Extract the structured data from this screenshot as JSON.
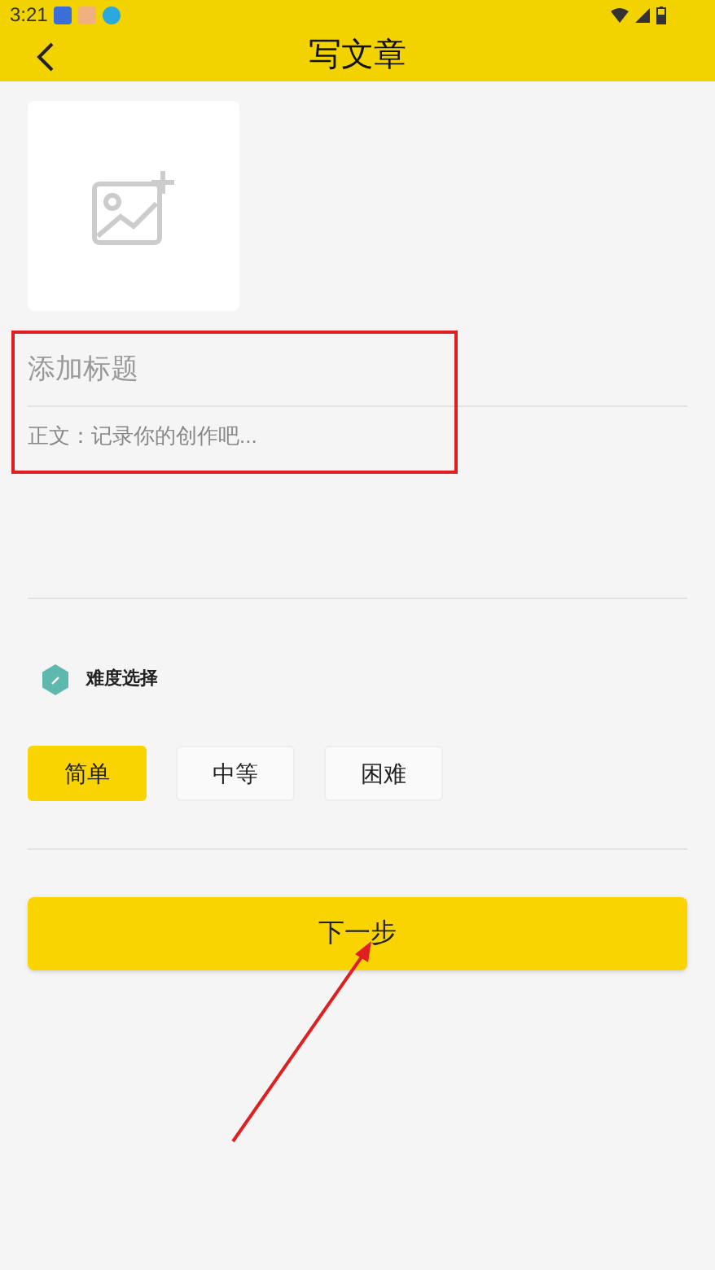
{
  "status_bar": {
    "time": "3:21"
  },
  "header": {
    "title": "写文章"
  },
  "title_field": {
    "placeholder": "添加标题"
  },
  "body_field": {
    "placeholder": "正文：记录你的创作吧..."
  },
  "difficulty": {
    "label": "难度选择",
    "options": [
      {
        "label": "简单",
        "selected": true
      },
      {
        "label": "中等",
        "selected": false
      },
      {
        "label": "困难",
        "selected": false
      }
    ]
  },
  "next_button": {
    "label": "下一步"
  }
}
